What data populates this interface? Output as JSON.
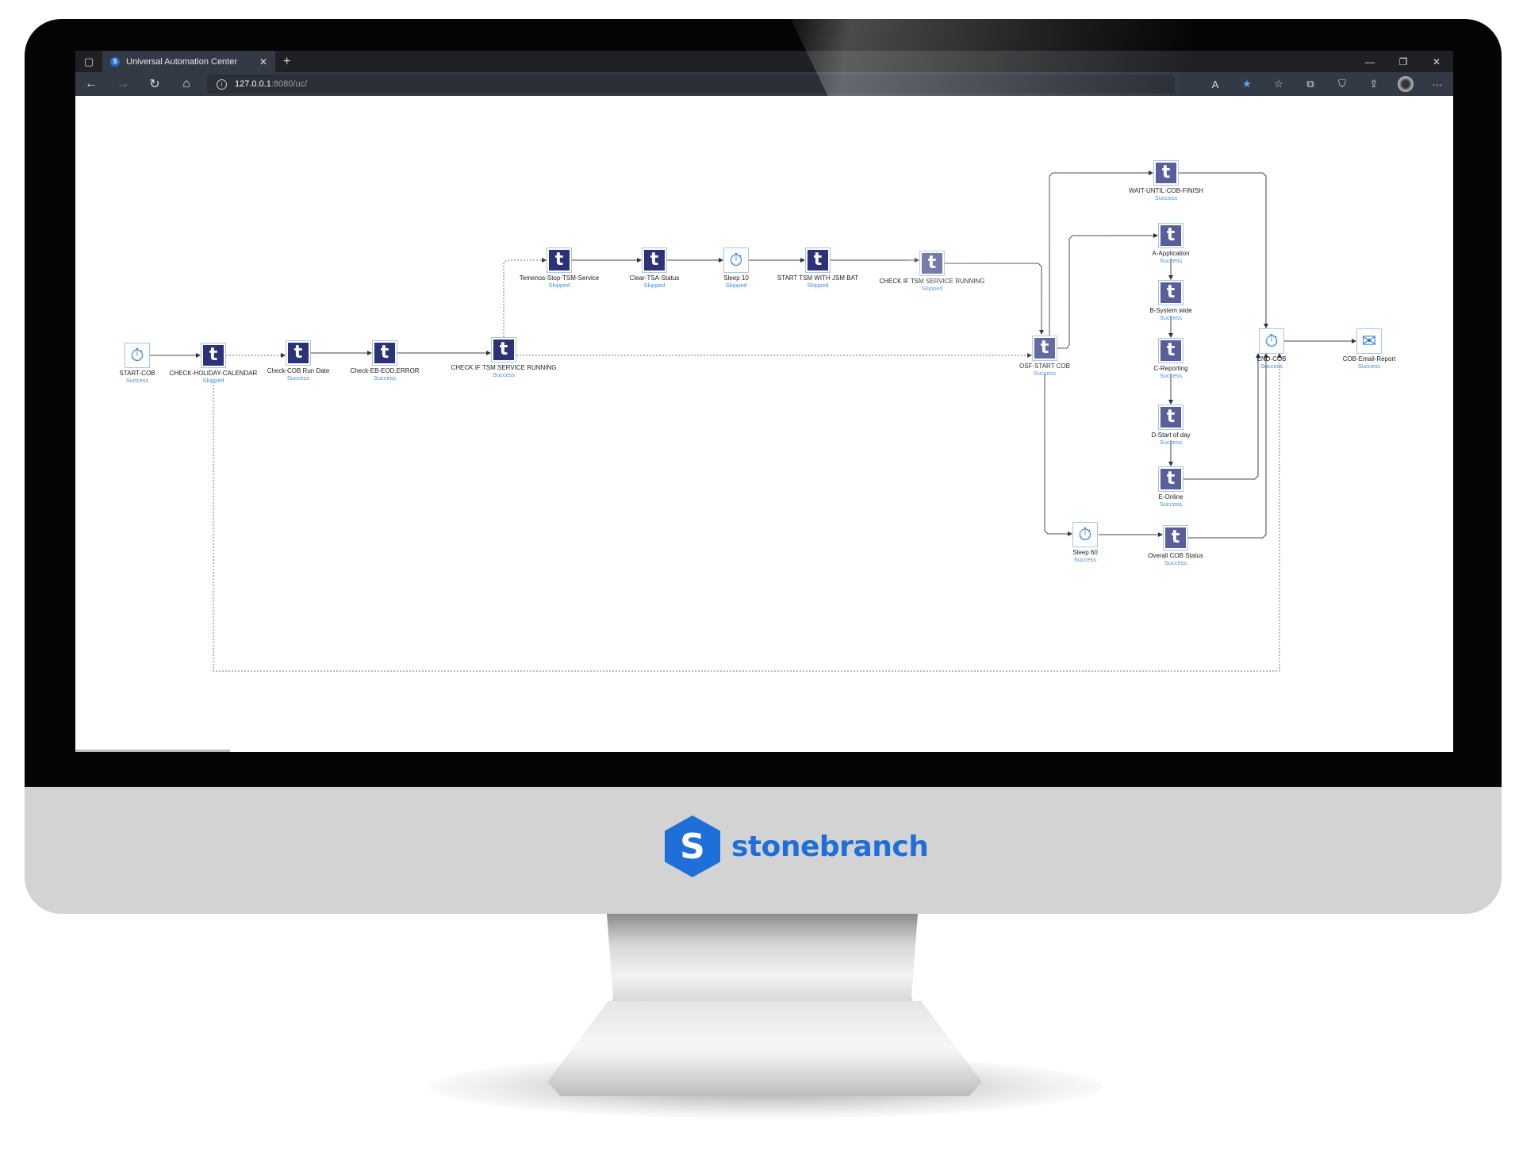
{
  "browser": {
    "tab_title": "Universal Automation Center",
    "tab_favicon": "S",
    "url_host": "127.0.0.1",
    "url_path": ":8080/uc/",
    "icons": {
      "tab_actions": "▢",
      "close": "✕",
      "new_tab": "+",
      "minimize": "—",
      "restore": "❐",
      "window_close": "✕",
      "back": "←",
      "forward": "→",
      "refresh": "↻",
      "home": "⌂",
      "info": "i",
      "read_aloud": "A",
      "favorite": "★",
      "favorites": "☆",
      "collections": "⧉",
      "browser_essentials": "⛉",
      "share": "⇪",
      "more": "···"
    }
  },
  "workflow": {
    "nodes": [
      {
        "id": "start-cob",
        "label": "START-COB",
        "status": "Success",
        "type": "timer"
      },
      {
        "id": "check-holiday",
        "label": "CHECK-HOLIDAY-CALENDAR",
        "status": "Skipped",
        "type": "task"
      },
      {
        "id": "check-cob-run-date",
        "label": "Check-COB Run Date",
        "status": "Success",
        "type": "task"
      },
      {
        "id": "check-eb-eod",
        "label": "Check-EB-EOD.ERROR",
        "status": "Success",
        "type": "task"
      },
      {
        "id": "check-tsm-1",
        "label": "CHECK IF TSM SERVICE RUNNING",
        "status": "Success",
        "type": "task"
      },
      {
        "id": "temenos-stop",
        "label": "Temenos-Stop-TSM-Service",
        "status": "Skipped",
        "type": "task"
      },
      {
        "id": "clear-tsa",
        "label": "Clear-TSA-Status",
        "status": "Skipped",
        "type": "task"
      },
      {
        "id": "sleep-10",
        "label": "Sleep 10",
        "status": "Skipped",
        "type": "timer"
      },
      {
        "id": "start-tsm-jsm",
        "label": "START TSM WITH JSM BAT",
        "status": "Skipped",
        "type": "task"
      },
      {
        "id": "check-tsm-2",
        "label": "CHECK IF TSM SERVICE RUNNING",
        "status": "Skipped",
        "type": "task"
      },
      {
        "id": "osf-start-cob",
        "label": "OSF-START COB",
        "status": "Success",
        "type": "task"
      },
      {
        "id": "wait-until-cob",
        "label": "WAIT-UNTIL-COB-FINISH",
        "status": "Success",
        "type": "task"
      },
      {
        "id": "a-application",
        "label": "A-Application",
        "status": "Success",
        "type": "task"
      },
      {
        "id": "b-system-wide",
        "label": "B-System wide",
        "status": "Success",
        "type": "task"
      },
      {
        "id": "c-reporting",
        "label": "C-Reporting",
        "status": "Success",
        "type": "task"
      },
      {
        "id": "d-start-of-day",
        "label": "D-Start of day",
        "status": "Success",
        "type": "task"
      },
      {
        "id": "e-online",
        "label": "E-Online",
        "status": "Success",
        "type": "task"
      },
      {
        "id": "sleep-60",
        "label": "Sleep 60",
        "status": "Success",
        "type": "timer"
      },
      {
        "id": "overall-cob-status",
        "label": "Overall COB Status",
        "status": "Success",
        "type": "task"
      },
      {
        "id": "end-cob",
        "label": "END-COB",
        "status": "Success",
        "type": "timer"
      },
      {
        "id": "cob-email-report",
        "label": "COB-Email-Report",
        "status": "Success",
        "type": "email"
      }
    ],
    "icons": {
      "task": "t",
      "timer": "⏱",
      "email": "✉"
    }
  },
  "monitor": {
    "brand_mark": "S",
    "brand_name": "stonebranch"
  }
}
